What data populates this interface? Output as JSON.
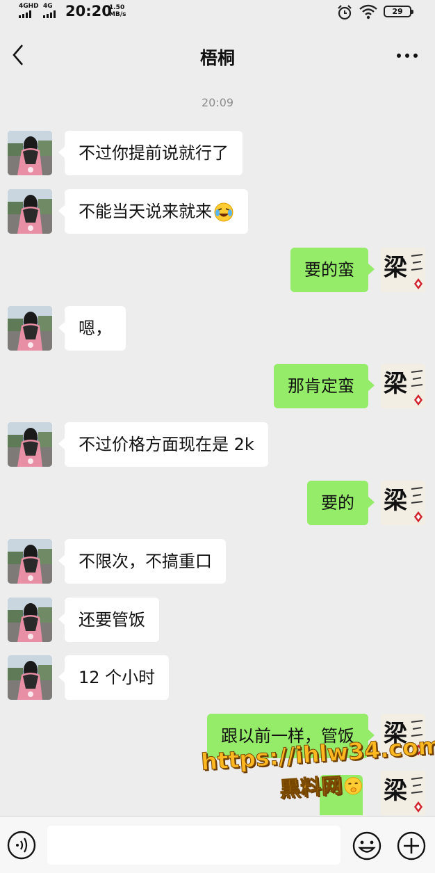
{
  "status_bar": {
    "network_1": "4GHD",
    "network_2": "4G",
    "time": "20:20",
    "speed_value": "1.50",
    "speed_unit": "MB/s",
    "battery": "29"
  },
  "header": {
    "title": "梧桐"
  },
  "timestamp": "20:09",
  "messages": [
    {
      "side": "left",
      "text": "不过你提前说就行了"
    },
    {
      "side": "left",
      "text": "不能当天说来就来"
    },
    {
      "side": "right",
      "text": "要的蛮"
    },
    {
      "side": "left",
      "text": "嗯，"
    },
    {
      "side": "right",
      "text": "那肯定蛮"
    },
    {
      "side": "left",
      "text": "不过价格方面现在是 2k"
    },
    {
      "side": "right",
      "text": "要的"
    },
    {
      "side": "left",
      "text": "不限次，不搞重口"
    },
    {
      "side": "left",
      "text": "还要管饭"
    },
    {
      "side": "left",
      "text": "12 个小时"
    },
    {
      "side": "right",
      "text": "跟以前一样，管饭"
    }
  ],
  "watermark": {
    "url": "https://ihlw34.com",
    "name": "黑料网"
  },
  "input": {
    "placeholder": ""
  },
  "colors": {
    "background": "#ededed",
    "sent_bubble": "#95ec69",
    "received_bubble": "#ffffff",
    "watermark": "#ffb820"
  }
}
